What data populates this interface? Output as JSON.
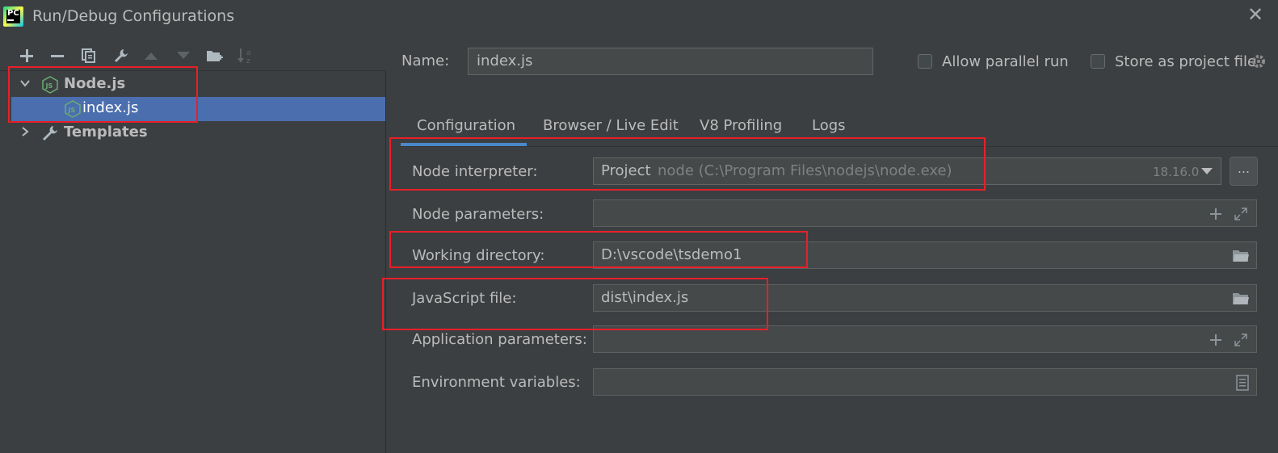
{
  "window": {
    "title": "Run/Debug Configurations",
    "app_icon": "pycharm-logo",
    "app_icon_text": "PC",
    "close_icon": "close-icon"
  },
  "toolbar": {
    "buttons": [
      "add-icon",
      "remove-icon",
      "copy-icon",
      "wrench-icon",
      "move-up-icon",
      "move-down-icon",
      "new-folder-icon",
      "sort-icon"
    ]
  },
  "tree": {
    "nodejs_label": "Node.js",
    "index_label": "index.js",
    "templates_label": "Templates",
    "icon_text": "JS"
  },
  "name_row": {
    "label": "Name:",
    "value": "index.js",
    "allow_parallel_label": "Allow parallel run",
    "store_as_project_label": "Store as project file",
    "allow_parallel_checked": false,
    "store_as_project_checked": false
  },
  "tabs": [
    "Configuration",
    "Browser / Live Edit",
    "V8 Profiling",
    "Logs"
  ],
  "active_tab": "Configuration",
  "form": {
    "node_interpreter_label": "Node interpreter:",
    "interpreter_project": "Project",
    "interpreter_path": "node (C:\\Program Files\\nodejs\\node.exe)",
    "interpreter_version": "18.16.0",
    "dots_label": "...",
    "node_parameters_label": "Node parameters:",
    "node_parameters_value": "",
    "working_directory_label": "Working directory:",
    "working_directory_value": "D:\\vscode\\tsdemo1",
    "javascript_file_label": "JavaScript file:",
    "javascript_file_value": "dist\\index.js",
    "application_parameters_label": "Application parameters:",
    "application_parameters_value": "",
    "environment_variables_label": "Environment variables:",
    "environment_variables_value": ""
  },
  "colors": {
    "background": "#3c3f41",
    "selection": "#4b6eaf",
    "text": "#bbbbbb",
    "highlight_box": "#e81f28",
    "tab_underline": "#4a88c7"
  }
}
